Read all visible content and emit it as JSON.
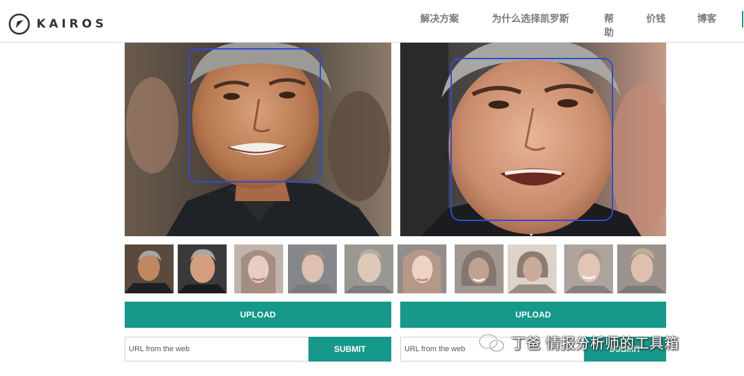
{
  "brand": {
    "name": "KAIROS",
    "accent": "#16988a"
  },
  "nav": [
    {
      "label": "解决方案"
    },
    {
      "label": "为什么选择凯罗斯"
    },
    {
      "label": "帮助"
    },
    {
      "label": "价钱"
    },
    {
      "label": "博客"
    }
  ],
  "panels": [
    {
      "upload_label": "UPLOAD",
      "url_placeholder": "URL from the web",
      "submit_label": "SUBMIT"
    },
    {
      "upload_label": "UPLOAD",
      "url_placeholder": "URL from the web",
      "submit_label": "SUBMIT"
    }
  ],
  "thumbnails_count": 10,
  "watermark": {
    "text": "丁爸 情报分析师的工具箱",
    "icon": "wechat-icon"
  }
}
